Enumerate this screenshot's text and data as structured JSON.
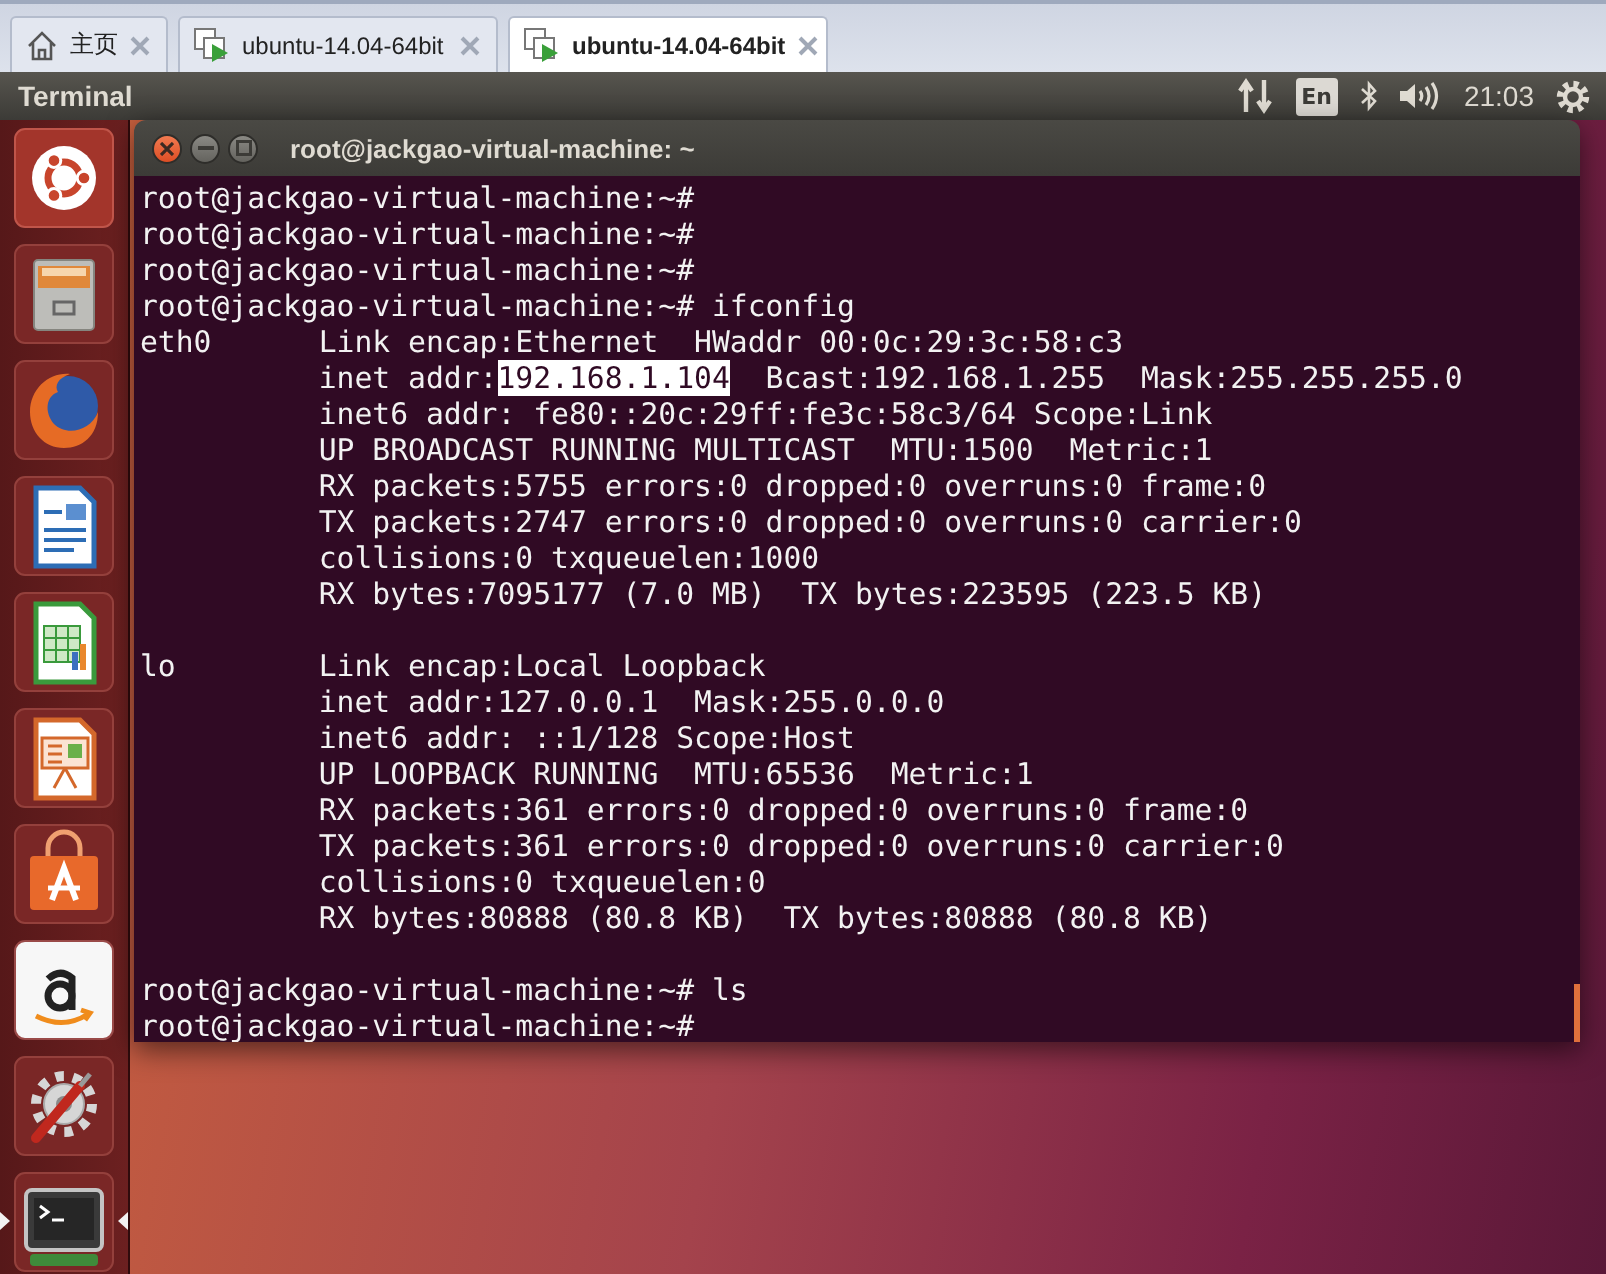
{
  "vm_tabs": [
    {
      "kind": "home",
      "label": "主页",
      "selected": false
    },
    {
      "kind": "vm",
      "label": "ubuntu-14.04-64bit",
      "selected": false
    },
    {
      "kind": "vm",
      "label": "ubuntu-14.04-64bit",
      "selected": true
    }
  ],
  "top_panel": {
    "app_title": "Terminal",
    "keyboard_layout": "En",
    "clock": "21:03"
  },
  "launcher": {
    "items": [
      {
        "kind": "dash",
        "running": false,
        "focused": false
      },
      {
        "kind": "files",
        "running": false,
        "focused": false
      },
      {
        "kind": "browser",
        "running": false,
        "focused": false
      },
      {
        "kind": "writer",
        "running": false,
        "focused": false
      },
      {
        "kind": "calc",
        "running": false,
        "focused": false
      },
      {
        "kind": "impress",
        "running": false,
        "focused": false
      },
      {
        "kind": "store",
        "running": false,
        "focused": false
      },
      {
        "kind": "amazon",
        "running": false,
        "focused": false
      },
      {
        "kind": "settings",
        "running": false,
        "focused": false
      },
      {
        "kind": "terminal",
        "running": true,
        "focused": true
      }
    ]
  },
  "terminal": {
    "title": "root@jackgao-virtual-machine: ~",
    "lines": [
      {
        "kind": "prompt",
        "text": "root@jackgao-virtual-machine:~#"
      },
      {
        "kind": "prompt",
        "text": "root@jackgao-virtual-machine:~#"
      },
      {
        "kind": "prompt",
        "text": "root@jackgao-virtual-machine:~#"
      },
      {
        "kind": "prompt",
        "text": "root@jackgao-virtual-machine:~# ifconfig"
      },
      {
        "kind": "output",
        "iface": "eth0",
        "segments": [
          {
            "text": "Link encap:Ethernet  HWaddr 00:0c:29:3c:58:c3",
            "selected": false
          }
        ]
      },
      {
        "kind": "output",
        "segments": [
          {
            "text": "inet addr:",
            "selected": false
          },
          {
            "text": "192.168.1.104",
            "selected": true
          },
          {
            "text": "  Bcast:192.168.1.255  Mask:255.255.255.0",
            "selected": false
          }
        ]
      },
      {
        "kind": "output",
        "segments": [
          {
            "text": "inet6 addr: fe80::20c:29ff:fe3c:58c3/64 Scope:Link",
            "selected": false
          }
        ]
      },
      {
        "kind": "output",
        "segments": [
          {
            "text": "UP BROADCAST RUNNING MULTICAST  MTU:1500  Metric:1",
            "selected": false
          }
        ]
      },
      {
        "kind": "output",
        "segments": [
          {
            "text": "RX packets:5755 errors:0 dropped:0 overruns:0 frame:0",
            "selected": false
          }
        ]
      },
      {
        "kind": "output",
        "segments": [
          {
            "text": "TX packets:2747 errors:0 dropped:0 overruns:0 carrier:0",
            "selected": false
          }
        ]
      },
      {
        "kind": "output",
        "segments": [
          {
            "text": "collisions:0 txqueuelen:1000",
            "selected": false
          }
        ]
      },
      {
        "kind": "output",
        "segments": [
          {
            "text": "RX bytes:7095177 (7.0 MB)  TX bytes:223595 (223.5 KB)",
            "selected": false
          }
        ]
      },
      {
        "kind": "blank"
      },
      {
        "kind": "output",
        "iface": "lo",
        "segments": [
          {
            "text": "Link encap:Local Loopback",
            "selected": false
          }
        ]
      },
      {
        "kind": "output",
        "segments": [
          {
            "text": "inet addr:127.0.0.1  Mask:255.0.0.0",
            "selected": false
          }
        ]
      },
      {
        "kind": "output",
        "segments": [
          {
            "text": "inet6 addr: ::1/128 Scope:Host",
            "selected": false
          }
        ]
      },
      {
        "kind": "output",
        "segments": [
          {
            "text": "UP LOOPBACK RUNNING  MTU:65536  Metric:1",
            "selected": false
          }
        ]
      },
      {
        "kind": "output",
        "segments": [
          {
            "text": "RX packets:361 errors:0 dropped:0 overruns:0 frame:0",
            "selected": false
          }
        ]
      },
      {
        "kind": "output",
        "segments": [
          {
            "text": "TX packets:361 errors:0 dropped:0 overruns:0 carrier:0",
            "selected": false
          }
        ]
      },
      {
        "kind": "output",
        "segments": [
          {
            "text": "collisions:0 txqueuelen:0",
            "selected": false
          }
        ]
      },
      {
        "kind": "output",
        "segments": [
          {
            "text": "RX bytes:80888 (80.8 KB)  TX bytes:80888 (80.8 KB)",
            "selected": false
          }
        ]
      },
      {
        "kind": "blank"
      },
      {
        "kind": "prompt",
        "text": "root@jackgao-virtual-machine:~# ls"
      },
      {
        "kind": "prompt",
        "text": "root@jackgao-virtual-machine:~#"
      }
    ]
  }
}
